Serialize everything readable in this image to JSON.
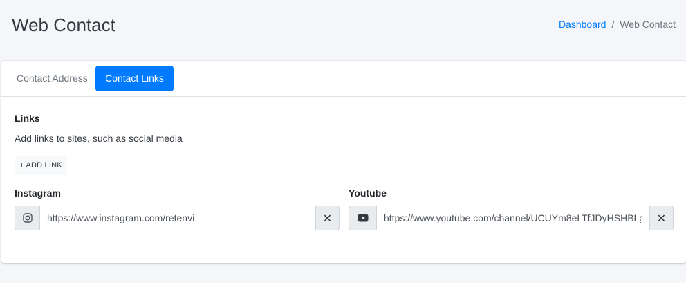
{
  "header": {
    "title": "Web Contact",
    "breadcrumb": {
      "link": "Dashboard",
      "separator": "/",
      "current": "Web Contact"
    }
  },
  "tabs": [
    {
      "label": "Contact Address",
      "active": false
    },
    {
      "label": "Contact Links",
      "active": true
    }
  ],
  "links_section": {
    "title": "Links",
    "description": "Add links to sites, such as social media",
    "add_button": "+ ADD LINK",
    "fields": [
      {
        "label": "Instagram",
        "icon": "instagram-icon",
        "value": "https://www.instagram.com/retenvi",
        "remove": "✕"
      },
      {
        "label": "Youtube",
        "icon": "youtube-icon",
        "value": "https://www.youtube.com/channel/UCUYm8eLTfJDyHSHBLg",
        "remove": "✕"
      }
    ]
  },
  "colors": {
    "primary": "#007bff",
    "background": "#f4f6f9",
    "card": "#ffffff"
  }
}
